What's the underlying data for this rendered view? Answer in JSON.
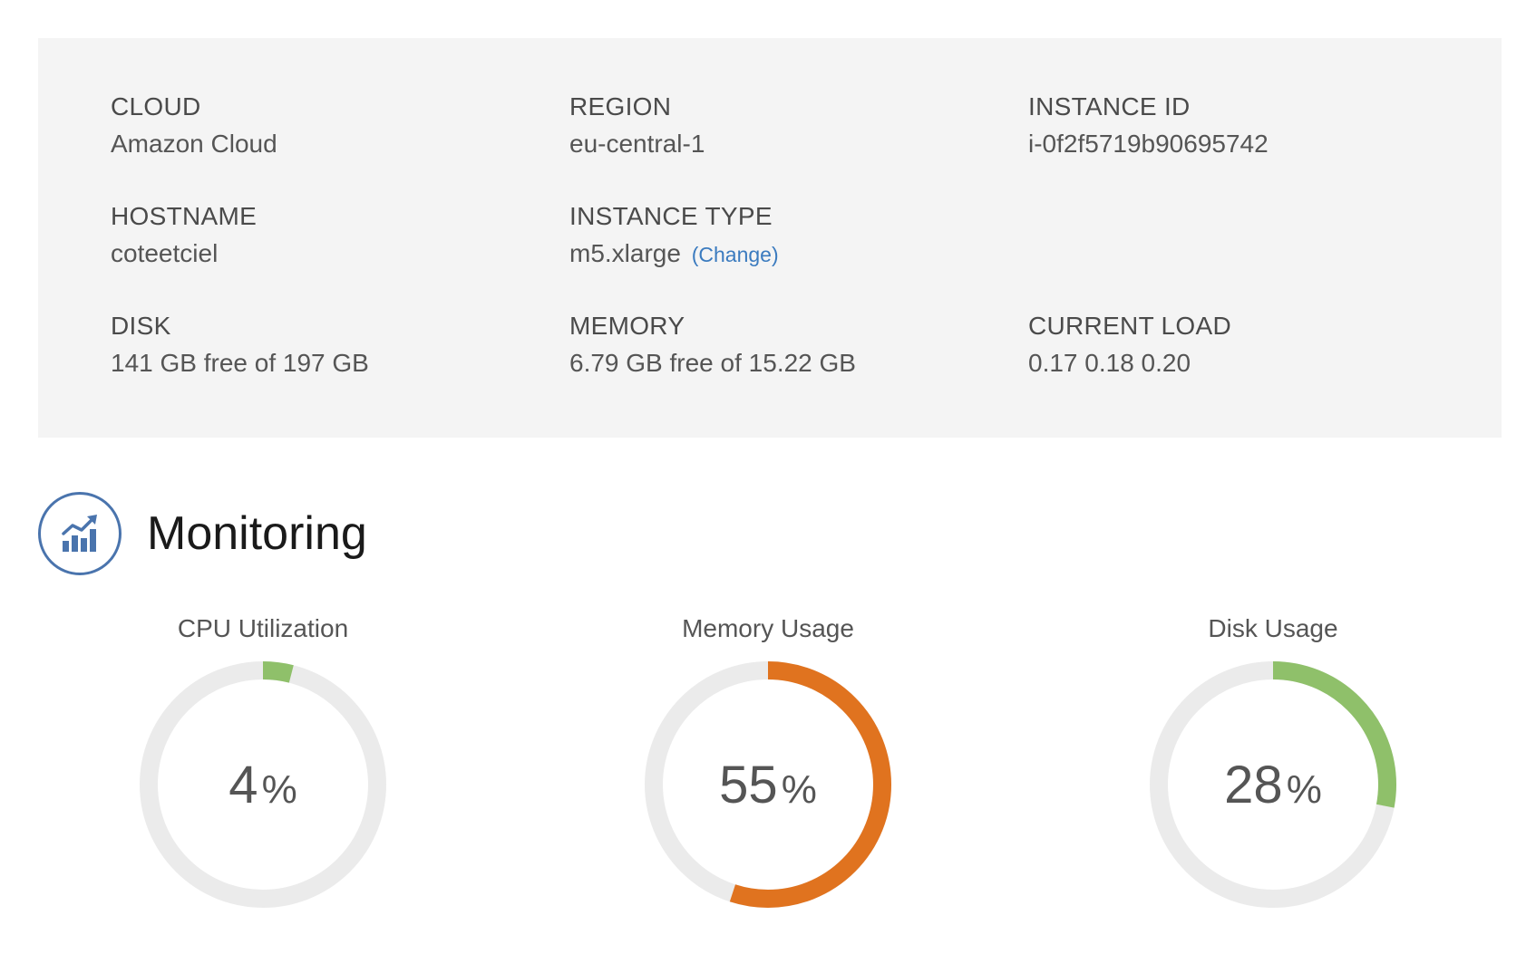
{
  "info": {
    "cloud": {
      "label": "CLOUD",
      "value": "Amazon Cloud"
    },
    "region": {
      "label": "REGION",
      "value": "eu-central-1"
    },
    "instance_id": {
      "label": "INSTANCE ID",
      "value": "i-0f2f5719b90695742"
    },
    "hostname": {
      "label": "HOSTNAME",
      "value": "coteetciel"
    },
    "instance_type": {
      "label": "INSTANCE TYPE",
      "value": "m5.xlarge",
      "change_link": "(Change)"
    },
    "disk": {
      "label": "DISK",
      "value": "141 GB free of 197 GB"
    },
    "memory": {
      "label": "MEMORY",
      "value": "6.79 GB free of 15.22 GB"
    },
    "current_load": {
      "label": "CURRENT LOAD",
      "value": "0.17 0.18 0.20"
    }
  },
  "monitoring": {
    "title": "Monitoring",
    "icon": "bar-chart-trend-icon"
  },
  "gauges": [
    {
      "title": "CPU Utilization",
      "percent": 4,
      "value_text": "4",
      "unit": "%",
      "color": "#8fc06a"
    },
    {
      "title": "Memory Usage",
      "percent": 55,
      "value_text": "55",
      "unit": "%",
      "color": "#e0731f"
    },
    {
      "title": "Disk Usage",
      "percent": 28,
      "value_text": "28",
      "unit": "%",
      "color": "#8fc06a"
    }
  ],
  "colors": {
    "panel_bg": "#f4f4f4",
    "track": "#ebebeb",
    "link": "#3b7bbf",
    "icon": "#4a74ad"
  }
}
